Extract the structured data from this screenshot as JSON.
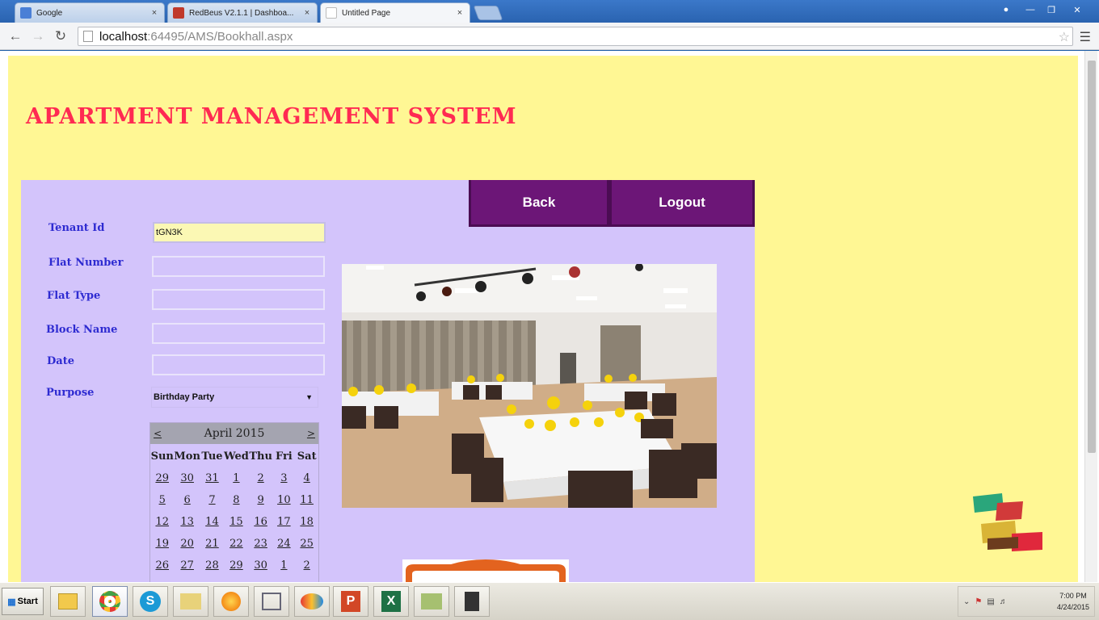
{
  "browser": {
    "tabs": [
      {
        "label": "Google",
        "icon": "google-icon",
        "color": "#4a7fd6"
      },
      {
        "label": "RedBeus V2.1.1 | Dashboa...",
        "icon": "redbeus-icon",
        "color": "#c0392b"
      },
      {
        "label": "Untitled Page",
        "icon": "page-icon",
        "color": "#ffffff"
      }
    ],
    "url_host": "localhost",
    "url_path": ":64495/AMS/Bookhall.aspx"
  },
  "page": {
    "title": "Apartment Management System",
    "nav": {
      "back": "Back",
      "logout": "Logout"
    },
    "form": {
      "tenant_id_label": "Tenant Id",
      "tenant_id_value": "tGN3K",
      "flat_number_label": "Flat Number",
      "flat_number_value": "",
      "flat_type_label": "Flat Type",
      "flat_type_value": "",
      "block_name_label": "Block Name",
      "block_name_value": "",
      "date_label": "Date",
      "date_value": "",
      "purpose_label": "Purpose",
      "purpose_value": "Birthday Party"
    },
    "calendar": {
      "month": "April 2015",
      "prev": "<",
      "next": ">",
      "weekdays": [
        "Sun",
        "Mon",
        "Tue",
        "Wed",
        "Thu",
        "Fri",
        "Sat"
      ],
      "weeks": [
        [
          "29",
          "30",
          "31",
          "1",
          "2",
          "3",
          "4"
        ],
        [
          "5",
          "6",
          "7",
          "8",
          "9",
          "10",
          "11"
        ],
        [
          "12",
          "13",
          "14",
          "15",
          "16",
          "17",
          "18"
        ],
        [
          "19",
          "20",
          "21",
          "22",
          "23",
          "24",
          "25"
        ],
        [
          "26",
          "27",
          "28",
          "29",
          "30",
          "1",
          "2"
        ]
      ]
    }
  },
  "taskbar": {
    "start": "Start",
    "apps": [
      "explorer-icon",
      "chrome-icon",
      "skype-icon",
      "folder-icon",
      "firefox-icon",
      "network-icon",
      "paint-icon",
      "powerpoint-icon",
      "excel-icon",
      "notes-icon",
      "camera-icon"
    ],
    "time": "7:00 PM",
    "date": "4/24/2015"
  },
  "colors": {
    "page_bg": "#fff794",
    "panel_bg": "#d3c4fb",
    "nav_button": "#6c1677",
    "title": "#ff2a52",
    "label": "#2e2bd1"
  }
}
